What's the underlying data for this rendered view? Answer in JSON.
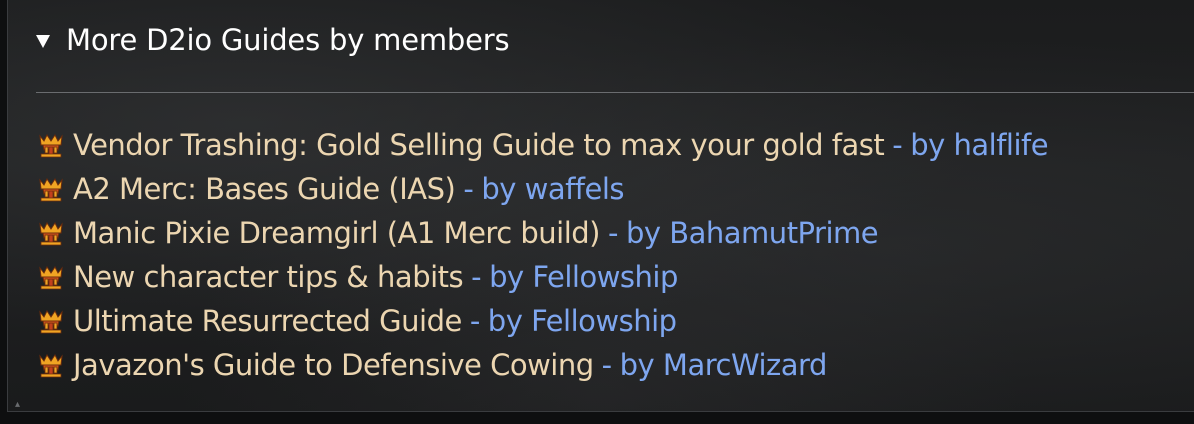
{
  "section": {
    "title": "More D2io Guides by members",
    "expanded": true
  },
  "guides": [
    {
      "title": "Vendor Trashing: Gold Selling Guide to max your gold fast",
      "separator": "-",
      "author": "by halflife"
    },
    {
      "title": "A2 Merc: Bases Guide (IAS)",
      "separator": "-",
      "author": "by waffels"
    },
    {
      "title": "Manic Pixie Dreamgirl (A1 Merc build)",
      "separator": "-",
      "author": "by BahamutPrime"
    },
    {
      "title": "New character tips & habits",
      "separator": "-",
      "author": "by Fellowship"
    },
    {
      "title": "Ultimate Resurrected Guide",
      "separator": "-",
      "author": "by Fellowship"
    },
    {
      "title": "Javazon's Guide to Defensive Cowing",
      "separator": "-",
      "author": "by MarcWizard"
    }
  ],
  "colors": {
    "title_text": "#ecd6b1",
    "author_text": "#7ea6ef",
    "header_text": "#ffffff",
    "icon_primary": "#f0a423",
    "icon_accent": "#c3401d"
  },
  "icons": {
    "toggle": "disclosure-triangle-down",
    "guide": "helmet-crown-icon"
  }
}
